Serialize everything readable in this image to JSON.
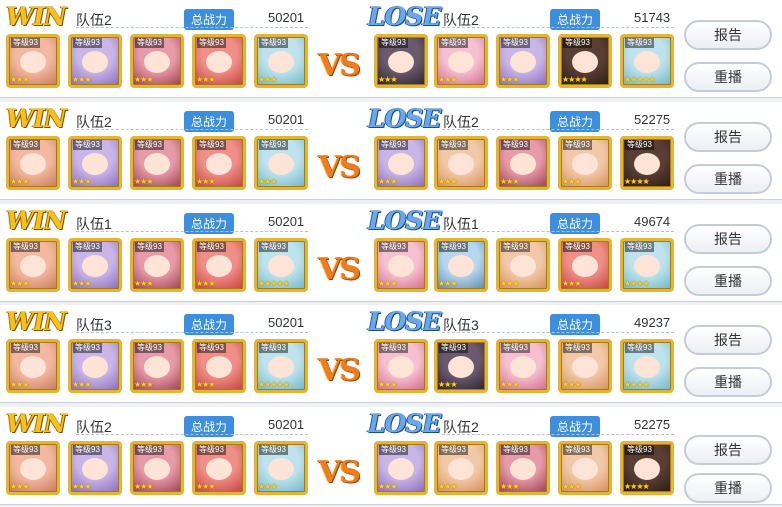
{
  "labels": {
    "vs": "VS",
    "power_label": "总战力",
    "level": "等级93"
  },
  "colors": {
    "win": "#f3c21b",
    "lose": "#6aa8ea",
    "vs": "#f07c20",
    "badge": "#3d8fde"
  },
  "rows": [
    {
      "left": {
        "result": "WIN",
        "team": "队伍2",
        "power": "50201",
        "units": [
          {
            "stars": "★★★"
          },
          {
            "stars": "★★★"
          },
          {
            "stars": "★★★"
          },
          {
            "stars": "★★★"
          },
          {
            "stars": "★★★"
          }
        ]
      },
      "right": {
        "result": "LOSE",
        "team": "队伍2",
        "power": "51743",
        "units": [
          {
            "stars": "★★★"
          },
          {
            "stars": "★★★"
          },
          {
            "stars": "★★★"
          },
          {
            "stars": "★★★★"
          },
          {
            "stars": "★★★★★"
          }
        ]
      },
      "report": "报告",
      "replay": "重播"
    },
    {
      "left": {
        "result": "WIN",
        "team": "队伍2",
        "power": "50201",
        "units": [
          {
            "stars": "★★★"
          },
          {
            "stars": "★★★"
          },
          {
            "stars": "★★★"
          },
          {
            "stars": "★★★"
          },
          {
            "stars": "★★★"
          }
        ]
      },
      "right": {
        "result": "LOSE",
        "team": "队伍2",
        "power": "52275",
        "units": [
          {
            "stars": "★★★"
          },
          {
            "stars": "★★★"
          },
          {
            "stars": "★★★"
          },
          {
            "stars": "★★★"
          },
          {
            "stars": "★★★★"
          }
        ]
      },
      "report": "报告",
      "replay": "重播"
    },
    {
      "left": {
        "result": "WIN",
        "team": "队伍1",
        "power": "50201",
        "units": [
          {
            "stars": "★★★"
          },
          {
            "stars": "★★★"
          },
          {
            "stars": "★★★"
          },
          {
            "stars": "★★★"
          },
          {
            "stars": "★★★★★"
          }
        ]
      },
      "right": {
        "result": "LOSE",
        "team": "队伍1",
        "power": "49674",
        "units": [
          {
            "stars": "★★★"
          },
          {
            "stars": "★★★"
          },
          {
            "stars": "★★★"
          },
          {
            "stars": "★★★"
          },
          {
            "stars": "★★★★"
          }
        ]
      },
      "report": "报告",
      "replay": "重播"
    },
    {
      "left": {
        "result": "WIN",
        "team": "队伍3",
        "power": "50201",
        "units": [
          {
            "stars": "★★★"
          },
          {
            "stars": "★★★"
          },
          {
            "stars": "★★★"
          },
          {
            "stars": "★★★"
          },
          {
            "stars": "★★★★★"
          }
        ]
      },
      "right": {
        "result": "LOSE",
        "team": "队伍3",
        "power": "49237",
        "units": [
          {
            "stars": "★★★"
          },
          {
            "stars": "★★★"
          },
          {
            "stars": "★★★"
          },
          {
            "stars": "★★★"
          },
          {
            "stars": "★★★★"
          }
        ]
      },
      "report": "报告",
      "replay": "重播"
    },
    {
      "left": {
        "result": "WIN",
        "team": "队伍2",
        "power": "50201",
        "units": [
          {
            "stars": "★★★"
          },
          {
            "stars": "★★★"
          },
          {
            "stars": "★★★"
          },
          {
            "stars": "★★★"
          },
          {
            "stars": "★★★"
          }
        ]
      },
      "right": {
        "result": "LOSE",
        "team": "队伍2",
        "power": "52275",
        "units": [
          {
            "stars": "★★★"
          },
          {
            "stars": "★★★"
          },
          {
            "stars": "★★★"
          },
          {
            "stars": "★★★"
          },
          {
            "stars": "★★★★"
          }
        ]
      },
      "report": "报告",
      "replay": "重播"
    }
  ]
}
